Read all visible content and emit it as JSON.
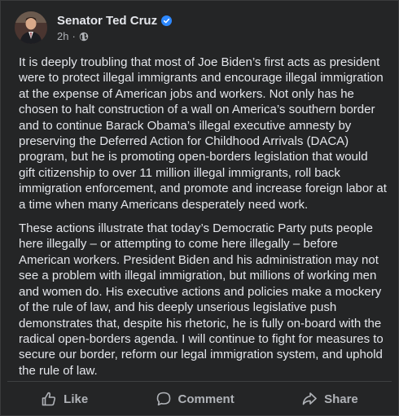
{
  "post": {
    "author": "Senator Ted Cruz",
    "verified": true,
    "timestamp": "2h",
    "separator": "·",
    "audience_icon": "globe-icon",
    "paragraphs": [
      "It is deeply troubling that most of Joe Biden’s first acts as president were to protect illegal immigrants and encourage illegal immigration at the expense of American jobs and workers. Not only has he chosen to halt construction of a wall on America’s southern border and to continue Barack Obama’s illegal executive amnesty by preserving the Deferred Action for Childhood Arrivals (DACA) program, but he is promoting open-borders legislation that would gift citizenship to over 11 million illegal immigrants, roll back immigration enforcement, and promote and increase foreign labor at a time when many Americans desperately need work.",
      "These actions illustrate that today’s Democratic Party puts people here illegally – or attempting to come here illegally – before American workers. President Biden and his administration may not see a problem with illegal immigration, but millions of working men and women do. His executive actions and policies make a mockery of the rule of law, and his deeply unserious legislative push demonstrates that, despite his rhetoric, he is fully on-board with the radical open-borders agenda.  I will continue to fight for measures to secure our border, reform our legal immigration system, and uphold the rule of law."
    ]
  },
  "actions": {
    "like": "Like",
    "comment": "Comment",
    "share": "Share"
  },
  "colors": {
    "background": "#242526",
    "text": "#e4e6eb",
    "secondary_text": "#b0b3b8",
    "verified_badge": "#2d88ff"
  }
}
